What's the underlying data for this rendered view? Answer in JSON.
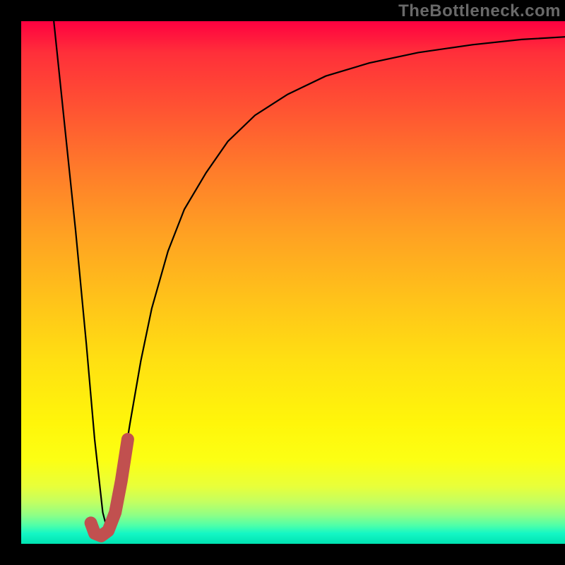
{
  "watermark": "TheBottleneck.com",
  "colors": {
    "frame": "#000000",
    "watermark_text": "#696969",
    "curve": "#000000",
    "accent_stroke": "#c1504f",
    "gradient_stops": [
      "#ff0040",
      "#ff2f3a",
      "#ff5432",
      "#ff7d2a",
      "#ffa222",
      "#ffc21a",
      "#ffe012",
      "#fff60a",
      "#fcff14",
      "#e8ff3a",
      "#c3ff61",
      "#8fff86",
      "#4effa9",
      "#14f7c5",
      "#00e3b2"
    ]
  },
  "chart_data": {
    "type": "line",
    "title": "",
    "xlabel": "",
    "ylabel": "",
    "xlim": [
      0,
      100
    ],
    "ylim": [
      0,
      100
    ],
    "series": [
      {
        "name": "curve",
        "x": [
          6,
          8,
          10,
          12,
          13.5,
          15,
          16,
          17,
          18,
          20,
          22,
          24,
          27,
          30,
          34,
          38,
          43,
          49,
          56,
          64,
          73,
          83,
          92,
          100
        ],
        "y": [
          100,
          80,
          60,
          38,
          20,
          6,
          2,
          4,
          10,
          23,
          35,
          45,
          56,
          64,
          71,
          77,
          82,
          86,
          89.5,
          92,
          94,
          95.5,
          96.5,
          97
        ]
      },
      {
        "name": "accent-j",
        "x": [
          12.8,
          13.5,
          14.7,
          16.0,
          17.3,
          18.4,
          19.6
        ],
        "y": [
          4.0,
          2.0,
          1.5,
          2.5,
          6.0,
          12.0,
          20.0
        ]
      }
    ],
    "note": "y-values are mismatch % (0 = bottom/green, 100 = top/red). Values estimated from pixels."
  }
}
